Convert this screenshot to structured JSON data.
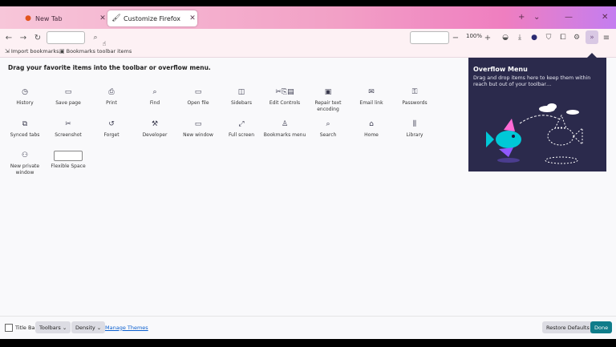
{
  "tabs": [
    {
      "title": "New Tab",
      "active": false
    },
    {
      "title": "Customize Firefox",
      "active": true
    }
  ],
  "navbar": {
    "zoom_value": "100%"
  },
  "bookmarks": [
    {
      "label": "Import bookmarks..."
    },
    {
      "label": "Bookmarks toolbar items"
    }
  ],
  "palette": {
    "title": "Drag your favorite items into the toolbar or overflow menu.",
    "rows": [
      [
        {
          "label": "History",
          "icon": "clock-icon",
          "glyph": "◷"
        },
        {
          "label": "Save page",
          "icon": "folder-icon",
          "glyph": "▭"
        },
        {
          "label": "Print",
          "icon": "printer-icon",
          "glyph": "⎙"
        },
        {
          "label": "Find",
          "icon": "magnifier-icon",
          "glyph": "⌕"
        },
        {
          "label": "Open file",
          "icon": "folder-open-icon",
          "glyph": "▭"
        },
        {
          "label": "Sidebars",
          "icon": "sidebar-icon",
          "glyph": "◫"
        },
        {
          "label": "Edit Controls",
          "icon": "edit-controls-icon",
          "glyph": "✂⎘▤"
        },
        {
          "label": "Repair text encoding",
          "icon": "encoding-icon",
          "glyph": "▣"
        },
        {
          "label": "Email link",
          "icon": "mail-icon",
          "glyph": "✉"
        },
        {
          "label": "Passwords",
          "icon": "key-icon",
          "glyph": "⚿"
        }
      ],
      [
        {
          "label": "Synced tabs",
          "icon": "synced-tabs-icon",
          "glyph": "⧉"
        },
        {
          "label": "Screenshot",
          "icon": "screenshot-icon",
          "glyph": "✂"
        },
        {
          "label": "Forget",
          "icon": "forget-icon",
          "glyph": "↺"
        },
        {
          "label": "Developer",
          "icon": "wrench-icon",
          "glyph": "⚒"
        },
        {
          "label": "New window",
          "icon": "window-icon",
          "glyph": "▭"
        },
        {
          "label": "Full screen",
          "icon": "fullscreen-icon",
          "glyph": "⤢"
        },
        {
          "label": "Bookmarks menu",
          "icon": "bookmarks-menu-icon",
          "glyph": "♙"
        },
        {
          "label": "Search",
          "icon": "search-icon",
          "glyph": "⌕"
        },
        {
          "label": "Home",
          "icon": "home-icon",
          "glyph": "⌂"
        },
        {
          "label": "Library",
          "icon": "library-icon",
          "glyph": "⫼"
        }
      ],
      [
        {
          "label": "New private window",
          "icon": "private-mask-icon",
          "glyph": "⚇"
        },
        {
          "label": "Flexible Space",
          "icon": "flexible-space-icon",
          "glyph": ""
        }
      ]
    ]
  },
  "overflow_panel": {
    "title": "Overflow Menu",
    "description": "Drag and drop items here to keep them within reach but out of your toolbar…"
  },
  "bottom": {
    "title_bar_label": "Title Bar",
    "toolbars_label": "Toolbars",
    "density_label": "Density",
    "manage_themes_label": "Manage Themes",
    "restore_label": "Restore Defaults",
    "done_label": "Done"
  },
  "colors": {
    "panel_bg": "#2b2a4c",
    "done_bg": "#0f7c8a",
    "accent_link": "#0b5fcf"
  }
}
